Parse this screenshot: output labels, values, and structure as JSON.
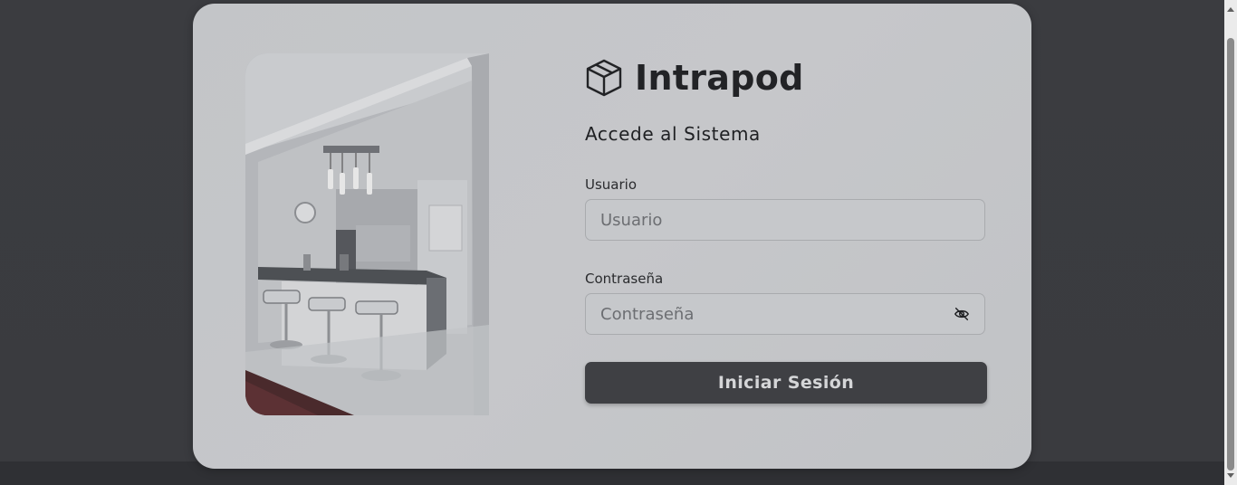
{
  "brand": {
    "name": "Intrapod",
    "icon": "box-icon"
  },
  "login": {
    "heading": "Accede al Sistema",
    "username_label": "Usuario",
    "username_placeholder": "Usuario",
    "password_label": "Contraseña",
    "password_placeholder": "Contraseña",
    "password_toggle_icon": "eye-slash-icon",
    "submit_label": "Iniciar Sesión"
  },
  "colors": {
    "overlay": "#3a3b3f",
    "card": "#c4c6c9",
    "button": "#3f4044",
    "text": "#222326"
  }
}
